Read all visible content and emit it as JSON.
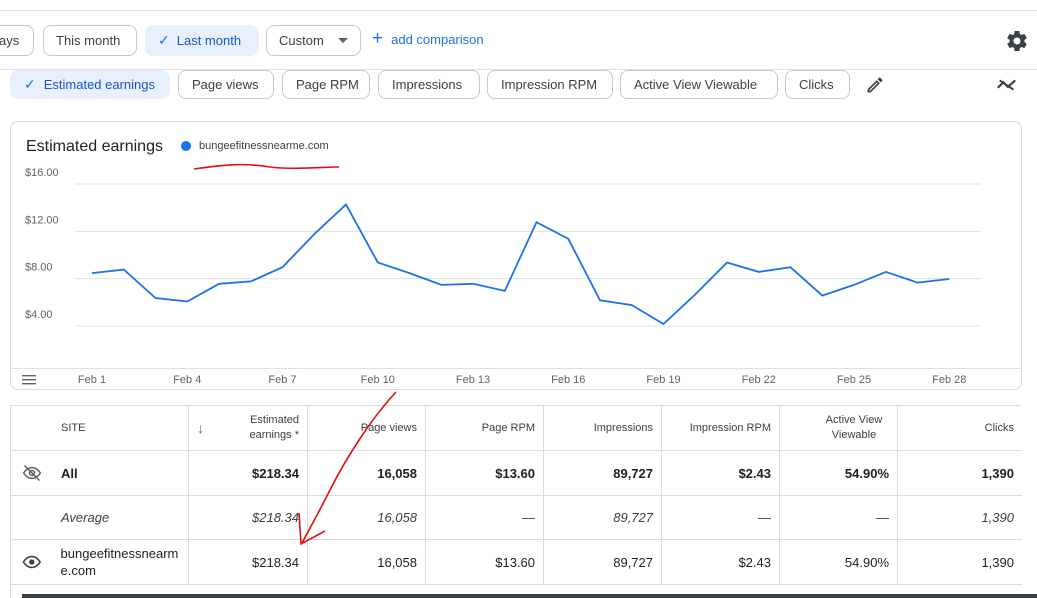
{
  "date_range": {
    "chips": [
      {
        "label": "ays",
        "selected": false
      },
      {
        "label": "This month",
        "selected": false
      },
      {
        "label": "Last month",
        "selected": true
      },
      {
        "label": "Custom",
        "selected": false
      }
    ],
    "add_comparison": "add comparison"
  },
  "metrics": [
    {
      "label": "Estimated earnings",
      "selected": true
    },
    {
      "label": "Page views",
      "selected": false
    },
    {
      "label": "Page RPM",
      "selected": false
    },
    {
      "label": "Impressions",
      "selected": false
    },
    {
      "label": "Impression RPM",
      "selected": false
    },
    {
      "label": "Active View Viewable",
      "selected": false
    },
    {
      "label": "Clicks",
      "selected": false
    }
  ],
  "chart": {
    "title": "Estimated earnings",
    "legend": "bungeefitnessnearme.com",
    "line_color": "#1a73e8"
  },
  "chart_data": {
    "type": "line",
    "title": "Estimated earnings",
    "x": [
      "Feb 1",
      "Feb 2",
      "Feb 3",
      "Feb 4",
      "Feb 5",
      "Feb 6",
      "Feb 7",
      "Feb 8",
      "Feb 9",
      "Feb 10",
      "Feb 11",
      "Feb 12",
      "Feb 13",
      "Feb 14",
      "Feb 15",
      "Feb 16",
      "Feb 17",
      "Feb 18",
      "Feb 19",
      "Feb 20",
      "Feb 21",
      "Feb 22",
      "Feb 23",
      "Feb 24",
      "Feb 25",
      "Feb 26",
      "Feb 27",
      "Feb 28",
      "Feb 29"
    ],
    "x_tick_labels": [
      "Feb 1",
      "Feb 4",
      "Feb 7",
      "Feb 10",
      "Feb 13",
      "Feb 16",
      "Feb 19",
      "Feb 22",
      "Feb 25",
      "Feb 28"
    ],
    "y_tick_labels": [
      "$16.00",
      "$12.00",
      "$8.00",
      "$4.00"
    ],
    "ylim": [
      4,
      16
    ],
    "series": [
      {
        "name": "bungeefitnessnearme.com",
        "values": [
          8.3,
          8.6,
          6.2,
          5.9,
          7.4,
          7.6,
          8.8,
          11.6,
          14.1,
          9.2,
          8.3,
          7.3,
          7.4,
          6.8,
          12.6,
          11.2,
          6.0,
          5.6,
          4.0,
          6.5,
          9.2,
          8.4,
          8.8,
          6.4,
          7.3,
          8.4,
          7.5,
          7.8,
          null
        ]
      }
    ],
    "grid": true,
    "legend_position": "top-left"
  },
  "table": {
    "headers": {
      "site": "SITE",
      "estimated_earnings": "Estimated earnings *",
      "page_views": "Page views",
      "page_rpm": "Page RPM",
      "impressions": "Impressions",
      "impression_rpm": "Impression RPM",
      "active_view": "Active View Viewable",
      "clicks": "Clicks"
    },
    "rows": [
      {
        "site": "All",
        "estimated_earnings": "$218.34",
        "page_views": "16,058",
        "page_rpm": "$13.60",
        "impressions": "89,727",
        "impression_rpm": "$2.43",
        "active_view": "54.90%",
        "clicks": "1,390"
      },
      {
        "site": "Average",
        "estimated_earnings": "$218.34",
        "page_views": "16,058",
        "page_rpm": "—",
        "impressions": "89,727",
        "impression_rpm": "—",
        "active_view": "—",
        "clicks": "1,390"
      },
      {
        "site": "bungeefitnessnearme.com",
        "estimated_earnings": "$218.34",
        "page_views": "16,058",
        "page_rpm": "$13.60",
        "impressions": "89,727",
        "impression_rpm": "$2.43",
        "active_view": "54.90%",
        "clicks": "1,390"
      }
    ]
  },
  "icons": {
    "settings": "gear-icon",
    "edit": "pencil-icon",
    "trend": "trending-icon",
    "hidden": "eye-off-icon",
    "visible": "eye-icon",
    "sort": "arrow-down-icon",
    "menu": "hamburger-icon"
  }
}
